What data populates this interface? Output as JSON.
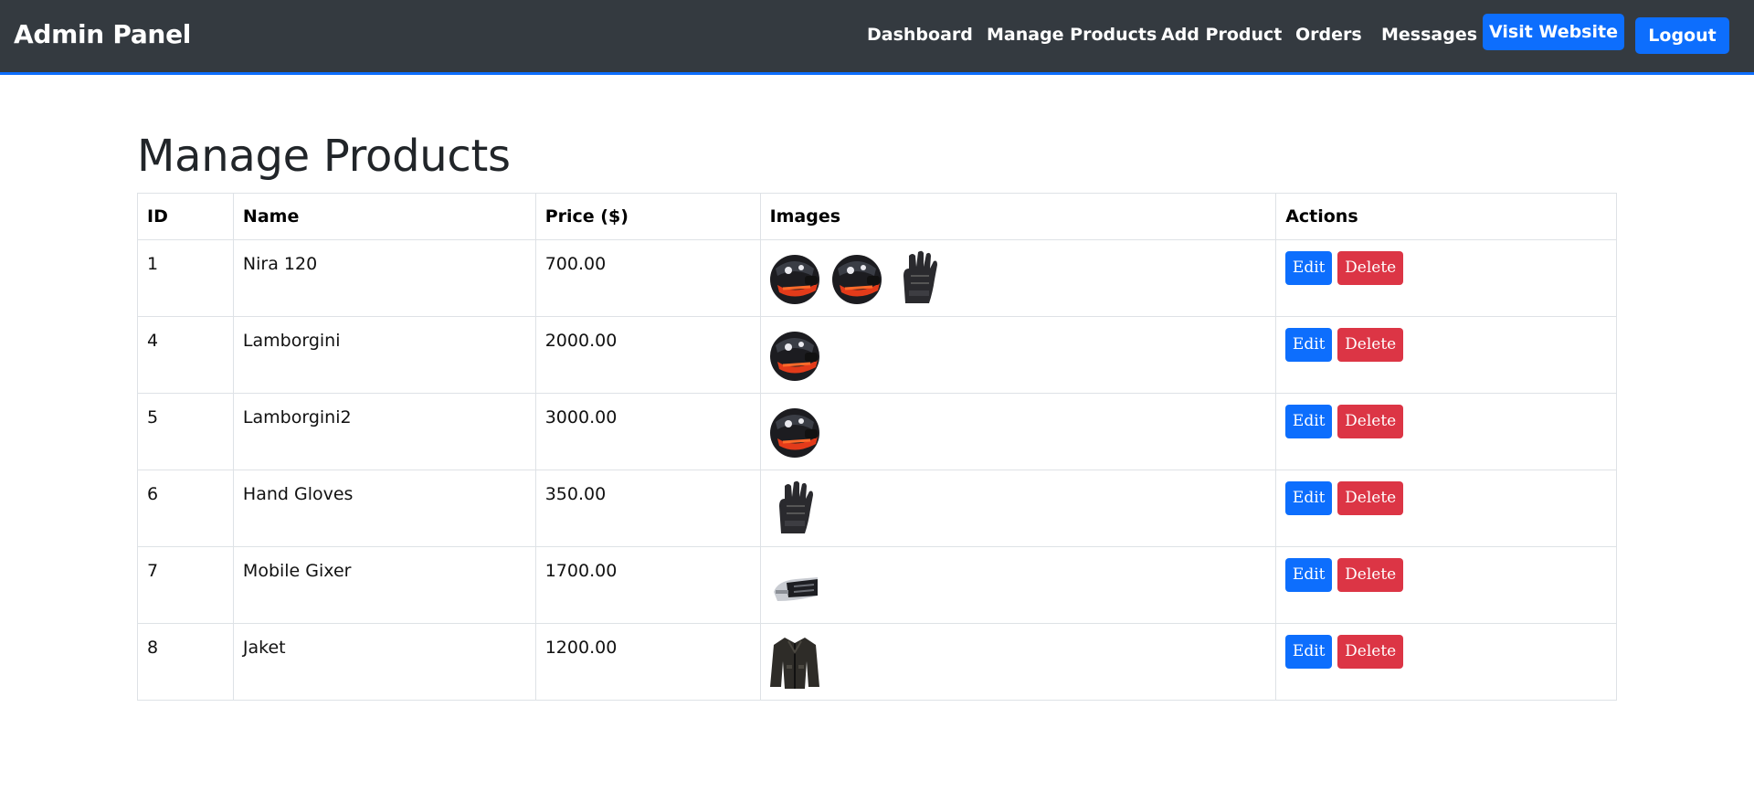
{
  "navbar": {
    "brand": "Admin Panel",
    "links": [
      "Dashboard",
      "Manage Products",
      "Add Product",
      "Orders",
      "Messages"
    ],
    "visit_website": "Visit Website",
    "logout": "Logout"
  },
  "page": {
    "title": "Manage Products"
  },
  "table": {
    "headers": [
      "ID",
      "Name",
      "Price ($)",
      "Images",
      "Actions"
    ],
    "rows": [
      {
        "id": "1",
        "name": "Nira 120",
        "price": "700.00",
        "images": [
          "helmet-image",
          "helmet-image",
          "gloves-image"
        ]
      },
      {
        "id": "4",
        "name": "Lamborgini",
        "price": "2000.00",
        "images": [
          "helmet-image"
        ]
      },
      {
        "id": "5",
        "name": "Lamborgini2",
        "price": "3000.00",
        "images": [
          "helmet-image"
        ]
      },
      {
        "id": "6",
        "name": "Hand Gloves",
        "price": "350.00",
        "images": [
          "gloves-image"
        ]
      },
      {
        "id": "7",
        "name": "Mobile Gixer",
        "price": "1700.00",
        "images": [
          "intercom-image"
        ]
      },
      {
        "id": "8",
        "name": "Jaket",
        "price": "1200.00",
        "images": [
          "jacket-image"
        ]
      }
    ],
    "edit_label": "Edit",
    "delete_label": "Delete"
  },
  "colors": {
    "navbar_bg": "#343a40",
    "accent": "#0d6efd",
    "danger": "#dc3545"
  }
}
